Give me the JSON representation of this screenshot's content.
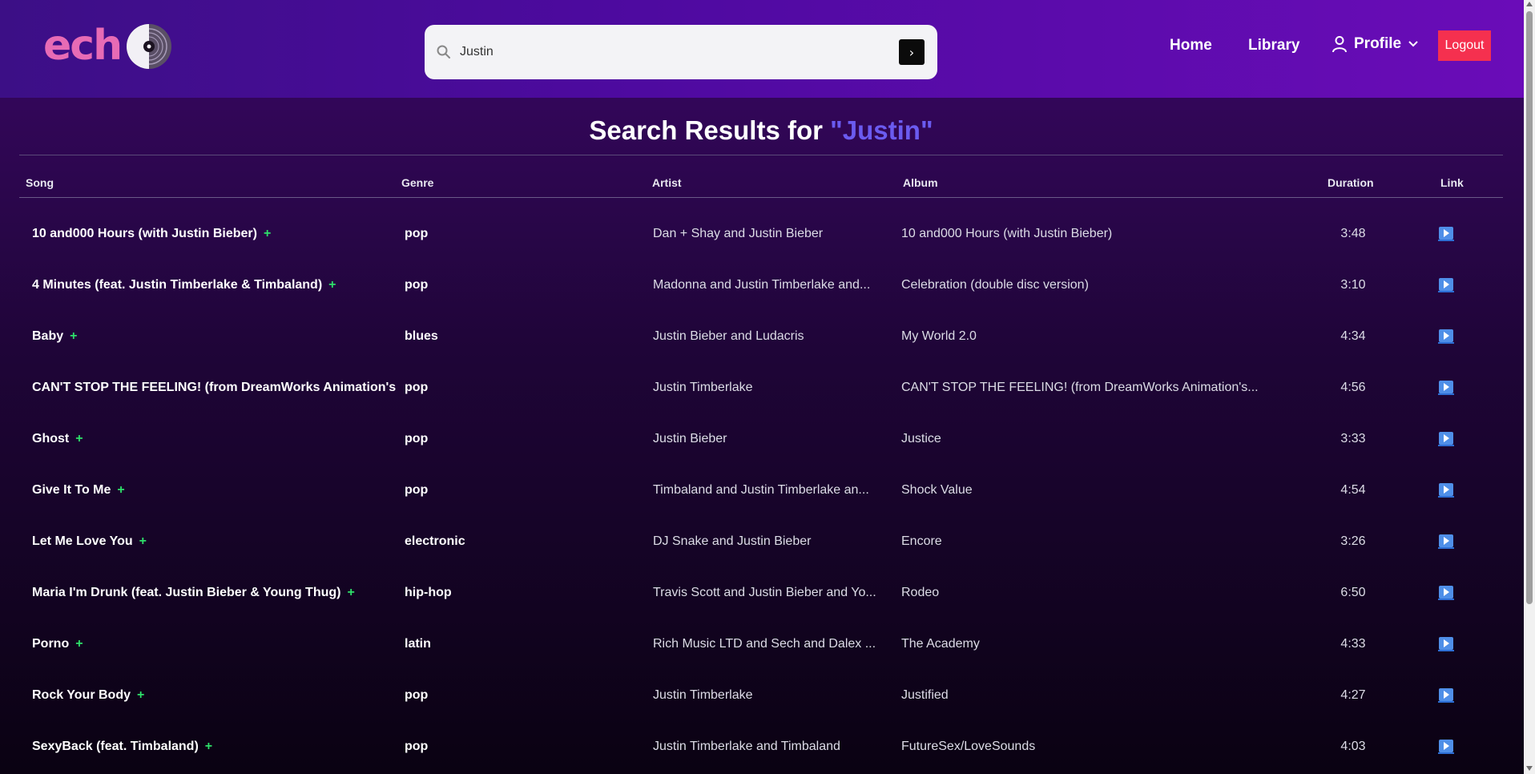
{
  "brand": {
    "logo_text": "echo"
  },
  "search": {
    "value": "Justin",
    "placeholder": "Search"
  },
  "nav": {
    "home": "Home",
    "library": "Library",
    "profile": "Profile",
    "logout": "Logout"
  },
  "results": {
    "prefix": "Search Results for ",
    "query": "\"Justin\""
  },
  "table": {
    "headers": {
      "song": "Song",
      "genre": "Genre",
      "artist": "Artist",
      "album": "Album",
      "duration": "Duration",
      "link": "Link"
    },
    "add_symbol": "+",
    "rows": [
      {
        "song": "10 and000 Hours (with Justin Bieber)",
        "genre": "pop",
        "artist": "Dan + Shay and Justin Bieber",
        "album": "10 and000 Hours (with Justin Bieber)",
        "duration": "3:48"
      },
      {
        "song": "4 Minutes (feat. Justin Timberlake & Timbaland)",
        "genre": "pop",
        "artist": "Madonna and Justin Timberlake and...",
        "album": "Celebration (double disc version)",
        "duration": "3:10"
      },
      {
        "song": "Baby",
        "genre": "blues",
        "artist": "Justin Bieber and Ludacris",
        "album": "My World 2.0",
        "duration": "4:34"
      },
      {
        "song": "CAN'T STOP THE FEELING! (from DreamWorks Animation's \"",
        "genre": "pop",
        "artist": "Justin Timberlake",
        "album": "CAN'T STOP THE FEELING! (from DreamWorks Animation's...",
        "duration": "4:56"
      },
      {
        "song": "Ghost",
        "genre": "pop",
        "artist": "Justin Bieber",
        "album": "Justice",
        "duration": "3:33"
      },
      {
        "song": "Give It To Me",
        "genre": "pop",
        "artist": "Timbaland and Justin Timberlake an...",
        "album": "Shock Value",
        "duration": "4:54"
      },
      {
        "song": "Let Me Love You",
        "genre": "electronic",
        "artist": "DJ Snake and Justin Bieber",
        "album": "Encore",
        "duration": "3:26"
      },
      {
        "song": "Maria I'm Drunk (feat. Justin Bieber & Young Thug)",
        "genre": "hip-hop",
        "artist": "Travis Scott and Justin Bieber and Yo...",
        "album": "Rodeo",
        "duration": "6:50"
      },
      {
        "song": "Porno",
        "genre": "latin",
        "artist": "Rich Music LTD and Sech and Dalex ...",
        "album": "The Academy",
        "duration": "4:33"
      },
      {
        "song": "Rock Your Body",
        "genre": "pop",
        "artist": "Justin Timberlake",
        "album": "Justified",
        "duration": "4:27"
      },
      {
        "song": "SexyBack (feat. Timbaland)",
        "genre": "pop",
        "artist": "Justin Timberlake and Timbaland",
        "album": "FutureSex/LoveSounds",
        "duration": "4:03"
      }
    ]
  },
  "colors": {
    "accent": "#6b5bf0",
    "logout": "#f5304f",
    "add": "#2ee06a",
    "logo": "#e76bb5",
    "link_icon": "#4f8fe8"
  },
  "icons": {
    "search": "search-icon",
    "go": "chevron-right-icon",
    "profile": "user-icon",
    "dropdown": "chevron-down-icon",
    "link": "play-icon"
  }
}
